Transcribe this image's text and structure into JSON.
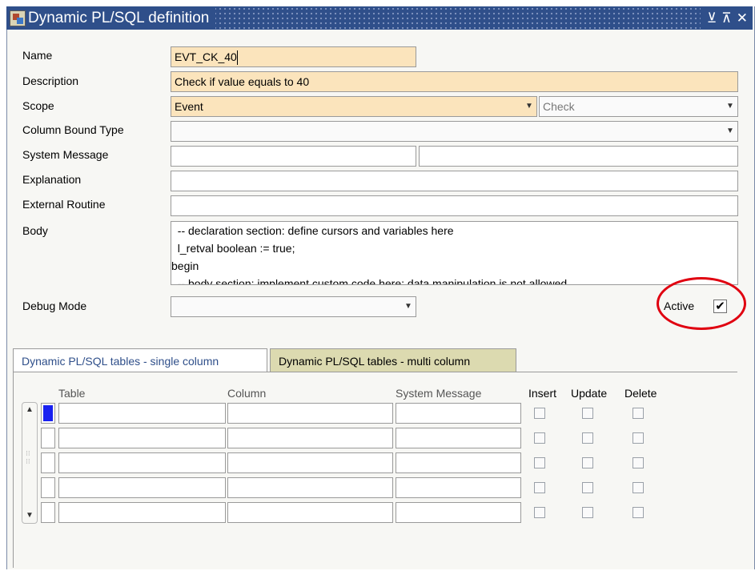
{
  "window": {
    "title": "Dynamic PL/SQL definition",
    "buttons": {
      "minimize": "⊻",
      "maximize": "⊼",
      "close": "✕"
    }
  },
  "form": {
    "name_label": "Name",
    "name_value": "EVT_CK_40",
    "description_label": "Description",
    "description_value": "Check if value equals to 40",
    "scope_label": "Scope",
    "scope_value": "Event",
    "scope_secondary_value": "Check",
    "column_bound_type_label": "Column Bound Type",
    "column_bound_type_value": "",
    "system_message_label": "System Message",
    "system_message_value_1": "",
    "system_message_value_2": "",
    "explanation_label": "Explanation",
    "explanation_value": "",
    "external_routine_label": "External Routine",
    "external_routine_value": "",
    "body_label": "Body",
    "body_lines": [
      "  -- declaration section: define cursors and variables here",
      "  l_retval boolean := true;",
      "begin",
      "  -- body section: implement custom code here; data manipulation is not allowed"
    ],
    "debug_mode_label": "Debug Mode",
    "debug_mode_value": "",
    "active_label": "Active",
    "active_checked": true,
    "active_mark": "✔"
  },
  "tabs": [
    {
      "label": "Dynamic PL/SQL tables - single column",
      "active": true
    },
    {
      "label": "Dynamic PL/SQL tables - multi column",
      "active": false
    }
  ],
  "grid": {
    "headers": {
      "table": "Table",
      "column": "Column",
      "system_message": "System Message",
      "insert": "Insert",
      "update": "Update",
      "delete": "Delete"
    },
    "rows": [
      {
        "table": "",
        "column": "",
        "system_message": "",
        "insert": false,
        "update": false,
        "delete": false
      },
      {
        "table": "",
        "column": "",
        "system_message": "",
        "insert": false,
        "update": false,
        "delete": false
      },
      {
        "table": "",
        "column": "",
        "system_message": "",
        "insert": false,
        "update": false,
        "delete": false
      },
      {
        "table": "",
        "column": "",
        "system_message": "",
        "insert": false,
        "update": false,
        "delete": false
      },
      {
        "table": "",
        "column": "",
        "system_message": "",
        "insert": false,
        "update": false,
        "delete": false
      }
    ]
  },
  "colors": {
    "title_bar": "#2f4f8a",
    "required_field": "#fbe4bc",
    "annotation_circle": "#e00010",
    "record_indicator": "#1820f0",
    "inactive_tab": "#dcdab0"
  },
  "icons": {
    "app": "forms-app-icon",
    "dropdown": "chevron-down-icon",
    "scroll_up": "arrow-up-icon",
    "scroll_down": "arrow-down-icon"
  }
}
